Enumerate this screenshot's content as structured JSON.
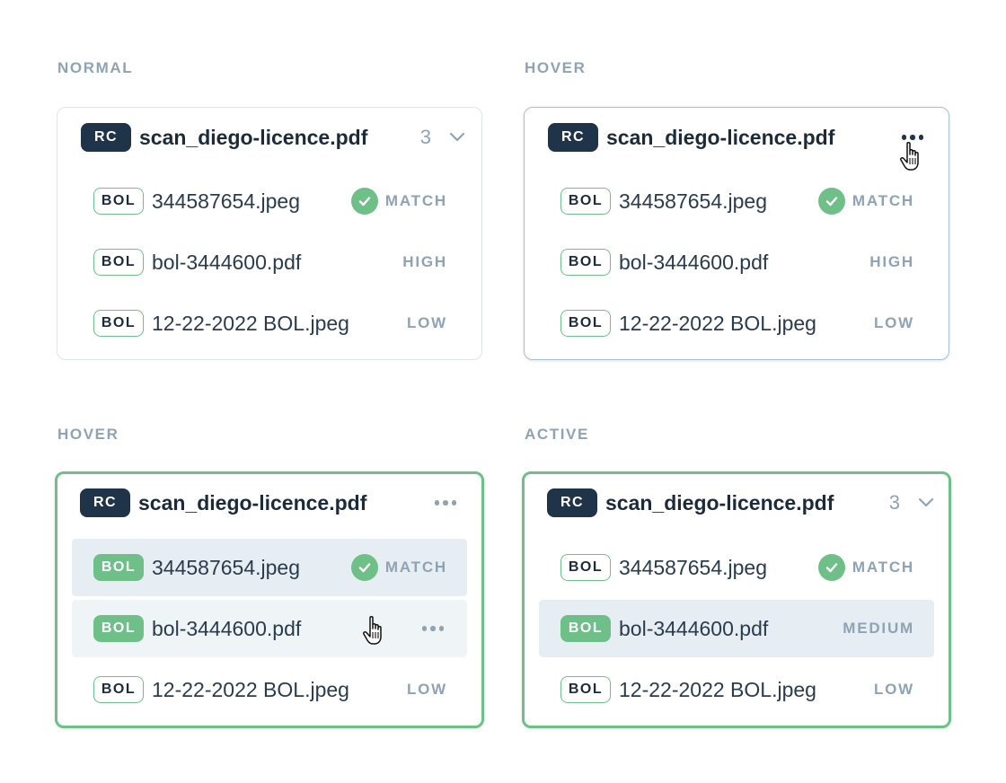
{
  "colors": {
    "accent_green": "#6fbf89",
    "badge_dark": "#1f3349",
    "muted_label": "#8ea3b3"
  },
  "icons": [
    "check-icon",
    "chevron-down-icon",
    "more-dots-icon",
    "hand-pointer-cursor"
  ],
  "cards": [
    {
      "state_label": "NORMAL",
      "header": {
        "badge": "RC",
        "title": "scan_diego-licence.pdf",
        "count": "3"
      },
      "rows": [
        {
          "badge": "BOL",
          "file": "344587654.jpeg",
          "status": "MATCH"
        },
        {
          "badge": "BOL",
          "file": "bol-3444600.pdf",
          "status": "HIGH"
        },
        {
          "badge": "BOL",
          "file": "12-22-2022 BOL.jpeg",
          "status": "LOW"
        }
      ]
    },
    {
      "state_label": "HOVER",
      "header": {
        "badge": "RC",
        "title": "scan_diego-licence.pdf"
      },
      "rows": [
        {
          "badge": "BOL",
          "file": "344587654.jpeg",
          "status": "MATCH"
        },
        {
          "badge": "BOL",
          "file": "bol-3444600.pdf",
          "status": "HIGH"
        },
        {
          "badge": "BOL",
          "file": "12-22-2022 BOL.jpeg",
          "status": "LOW"
        }
      ]
    },
    {
      "state_label": "HOVER",
      "header": {
        "badge": "RC",
        "title": "scan_diego-licence.pdf"
      },
      "rows": [
        {
          "badge": "BOL",
          "file": "344587654.jpeg",
          "status": "MATCH"
        },
        {
          "badge": "BOL",
          "file": "bol-3444600.pdf"
        },
        {
          "badge": "BOL",
          "file": "12-22-2022 BOL.jpeg",
          "status": "LOW"
        }
      ]
    },
    {
      "state_label": "ACTIVE",
      "header": {
        "badge": "RC",
        "title": "scan_diego-licence.pdf",
        "count": "3"
      },
      "rows": [
        {
          "badge": "BOL",
          "file": "344587654.jpeg",
          "status": "MATCH"
        },
        {
          "badge": "BOL",
          "file": "bol-3444600.pdf",
          "status": "MEDIUM"
        },
        {
          "badge": "BOL",
          "file": "12-22-2022 BOL.jpeg",
          "status": "LOW"
        }
      ]
    }
  ]
}
